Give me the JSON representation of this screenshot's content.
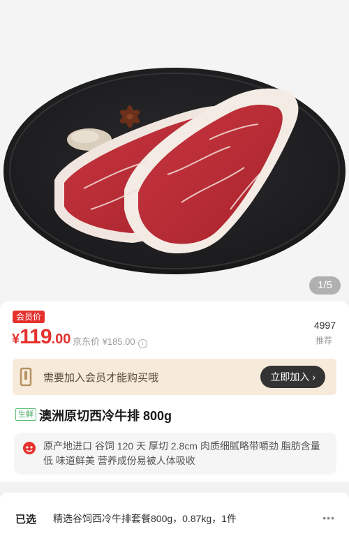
{
  "gallery": {
    "page_indicator": "1/5"
  },
  "price": {
    "member_tag": "会员价",
    "currency": "¥",
    "integer": "119",
    "decimal": ".00",
    "jd_price": "京东价 ¥185.00",
    "info_icon": "i",
    "recommend_count": "4997",
    "recommend_label": "推荐"
  },
  "member_banner": {
    "text": "需要加入会员才能购买哦",
    "join_button": "立即加入 ›"
  },
  "product": {
    "fresh_tag": "生鲜",
    "title": "澳洲原切西冷牛排 800g",
    "description": "原产地进口 谷饲 120 天 厚切 2.8cm 肉质细腻略带嚼劲 脂肪含量低 味道鲜美 营养成份易被人体吸收"
  },
  "selected": {
    "label": "已选",
    "value": "精选谷饲西冷牛排套餐800g，0.87kg，1件",
    "more": "•••"
  },
  "colors": {
    "accent_red": "#e5322f",
    "banner_bg": "#f6eadb",
    "fresh_green": "#3aa65a"
  },
  "icons": {
    "info": "info-icon",
    "member_card": "member-card-icon",
    "tag": "red-tag-icon",
    "more": "more-dots-icon"
  }
}
